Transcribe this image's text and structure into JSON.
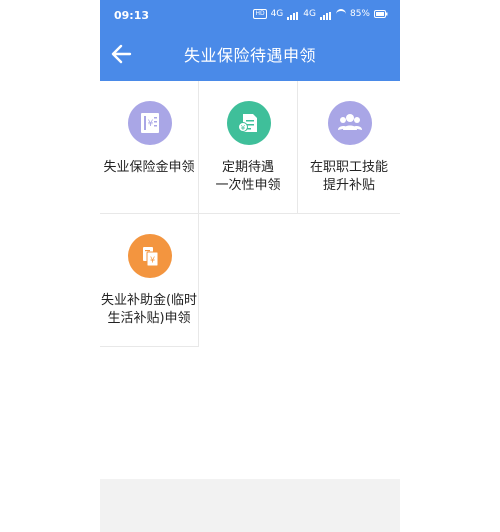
{
  "status_bar": {
    "time": "09:13",
    "battery": "85%",
    "network_1": "4G",
    "network_2": "4G",
    "hd": "HD"
  },
  "header": {
    "title": "失业保险待遇申领"
  },
  "colors": {
    "header": "#4a8ae8",
    "icon_purple": "#a9a6e6",
    "icon_green": "#3fbf9a",
    "icon_orange": "#f3953f"
  },
  "services": [
    {
      "label": "失业保险金申领",
      "icon": "receipt-icon"
    },
    {
      "label": "定期待遇\n一次性申领",
      "icon": "document-yen-icon"
    },
    {
      "label": "在职职工技能\n提升补贴",
      "icon": "people-icon"
    },
    {
      "label": "失业补助金(临时\n生活补贴)申领",
      "icon": "yen-card-icon"
    }
  ]
}
